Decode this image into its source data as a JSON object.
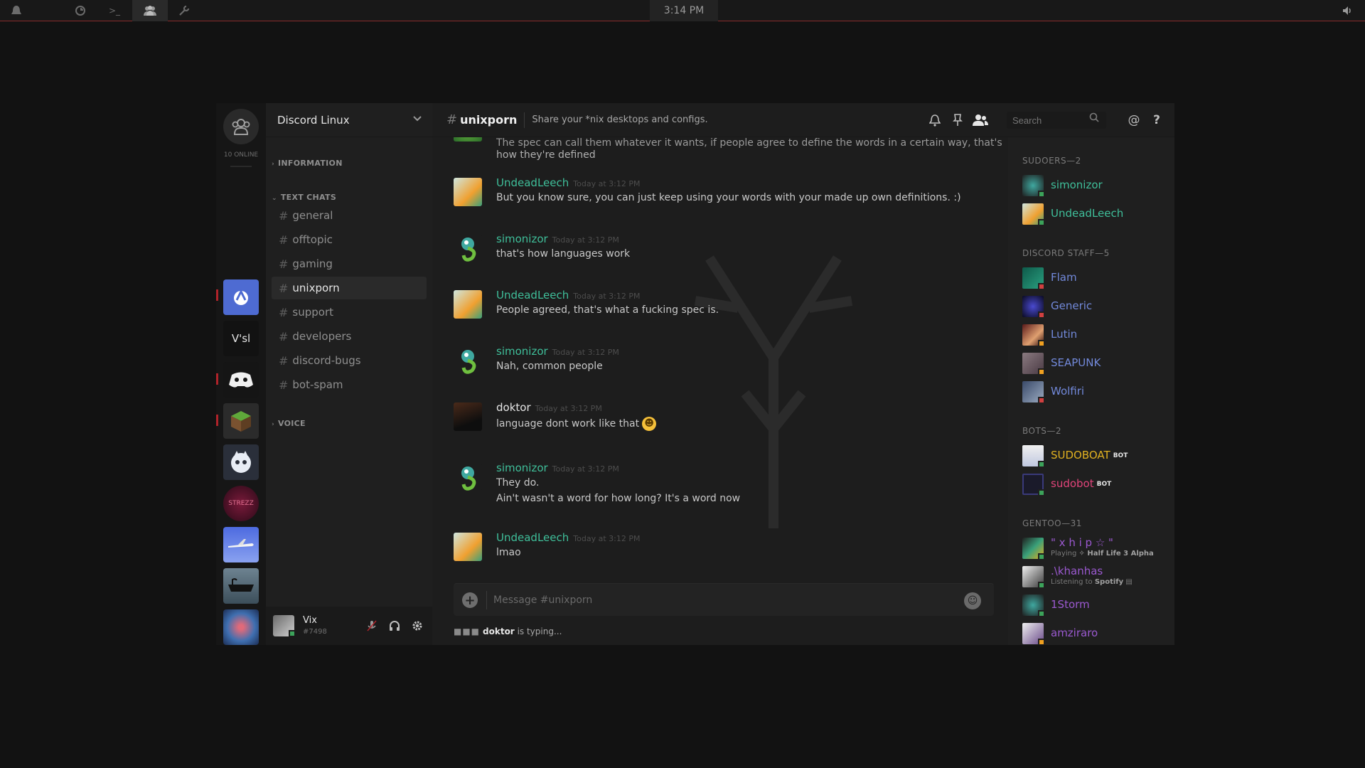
{
  "topbar": {
    "clock": "3:14 PM"
  },
  "server": {
    "name": "Discord Linux",
    "online": "10 ONLINE",
    "guilds": [
      {
        "id": "linux",
        "label": ""
      },
      {
        "id": "vsl",
        "label": "V'sl"
      },
      {
        "id": "discord",
        "label": ""
      },
      {
        "id": "minecraft",
        "label": ""
      },
      {
        "id": "mascot",
        "label": ""
      },
      {
        "id": "strezz",
        "label": "STREZZ"
      },
      {
        "id": "plane",
        "label": ""
      },
      {
        "id": "bath",
        "label": ""
      },
      {
        "id": "planet",
        "label": ""
      },
      {
        "id": "v-logo",
        "label": ""
      },
      {
        "id": "anime",
        "label": ""
      },
      {
        "id": "last",
        "label": ""
      }
    ]
  },
  "categories": {
    "information": "INFORMATION",
    "text_chats": "TEXT CHATS",
    "voice": "VOICE"
  },
  "channels": [
    {
      "name": "general"
    },
    {
      "name": "offtopic"
    },
    {
      "name": "gaming"
    },
    {
      "name": "unixporn"
    },
    {
      "name": "support"
    },
    {
      "name": "developers"
    },
    {
      "name": "discord-bugs"
    },
    {
      "name": "bot-spam"
    }
  ],
  "user": {
    "name": "Vix",
    "tag": "#7498"
  },
  "chat": {
    "channel": "unixporn",
    "topic": "Share your *nix desktops and configs.",
    "search_placeholder": "Search",
    "composer_placeholder": "Message #unixporn",
    "typing_user": "doktor",
    "typing_text": "is typing..."
  },
  "messages": [
    {
      "author": "",
      "time": "",
      "lines": [
        "The spec can call them whatever it wants, if people agree to define the words in a certain way, that's",
        "how they're defined"
      ]
    },
    {
      "author": "UndeadLeech",
      "time": "Today at 3:12 PM",
      "lines": [
        "But you know sure, you can just keep using your words with your made up own definitions. :)"
      ]
    },
    {
      "author": "simonizor",
      "time": "Today at 3:12 PM",
      "lines": [
        "that's how languages work"
      ]
    },
    {
      "author": "UndeadLeech",
      "time": "Today at 3:12 PM",
      "lines": [
        "People agreed, that's what a fucking spec is."
      ]
    },
    {
      "author": "simonizor",
      "time": "Today at 3:12 PM",
      "lines": [
        "Nah, common people"
      ]
    },
    {
      "author": "doktor",
      "time": "Today at 3:12 PM",
      "lines": [
        "language dont work like that"
      ]
    },
    {
      "author": "simonizor",
      "time": "Today at 3:12 PM",
      "lines": [
        "They do.",
        "Ain't wasn't a word for how long?  It's a word now"
      ]
    },
    {
      "author": "UndeadLeech",
      "time": "Today at 3:12 PM",
      "lines": [
        "lmao"
      ]
    }
  ],
  "members": {
    "sudoers_header": "SUDOERS—2",
    "sudoers": [
      {
        "name": "simonizor",
        "color": "#3fbf9a",
        "status": "online"
      },
      {
        "name": "UndeadLeech",
        "color": "#3fbf9a",
        "status": "online"
      }
    ],
    "staff_header": "DISCORD STAFF—5",
    "staff": [
      {
        "name": "Flam",
        "color": "#7289da",
        "status": "dnd"
      },
      {
        "name": "Generic",
        "color": "#7289da",
        "status": "dnd"
      },
      {
        "name": "Lutin",
        "color": "#7289da",
        "status": "idle"
      },
      {
        "name": "SEAPUNK",
        "color": "#7289da",
        "status": "idle"
      },
      {
        "name": "Wolfiri",
        "color": "#7289da",
        "status": "dnd"
      }
    ],
    "bots_header": "BOTS—2",
    "bots": [
      {
        "name": "SUDOBOAT",
        "color": "#e0b020",
        "badge": "BOT",
        "status": "online"
      },
      {
        "name": "sudobot",
        "color": "#e0447a",
        "badge": "BOT",
        "status": "online"
      }
    ],
    "gentoo_header": "GENTOO—31",
    "gentoo": [
      {
        "name": "\" x h i p ☆ \"",
        "color": "#9b59d0",
        "activity_prefix": "Playing",
        "activity": "✧ Half Life 3 Alpha",
        "status": "online"
      },
      {
        "name": ".\\khanhas",
        "color": "#9b59d0",
        "activity_prefix": "Listening to",
        "activity": "Spotify",
        "status": "online"
      },
      {
        "name": "1Storm",
        "color": "#9b59d0",
        "status": "online"
      },
      {
        "name": "amziraro",
        "color": "#9b59d0",
        "status": "idle"
      }
    ]
  },
  "colors": {
    "accent_red": "#b0232a",
    "online": "#3ca35a",
    "idle": "#f0a020",
    "dnd": "#d04040",
    "teal_role": "#3fbf9a",
    "staff_role": "#7289da"
  },
  "icons": {
    "topbar": [
      "app-menu-icon",
      "firefox-icon",
      "terminal-icon",
      "discord-icon",
      "tools-icon",
      "volume-icon"
    ],
    "header": [
      "bell-icon",
      "pin-icon",
      "members-icon",
      "search-icon",
      "mention-icon",
      "help-icon"
    ]
  }
}
